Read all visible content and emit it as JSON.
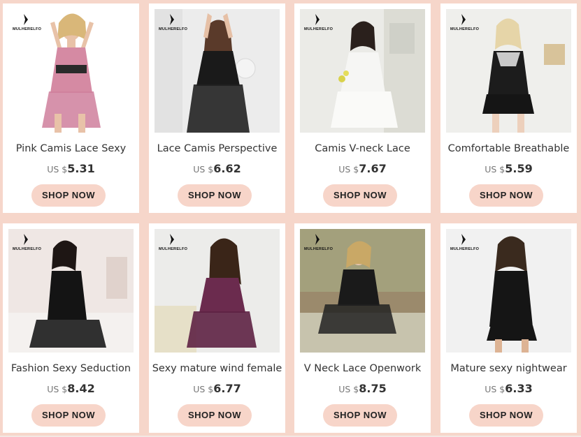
{
  "brand_name": "MULHERELFO",
  "shop_label": "SHOP NOW",
  "currency_prefix": "US $",
  "colors": {
    "page_bg": "#f6d6ca",
    "button_bg": "#f7d5c9",
    "card_bg": "#ffffff"
  },
  "products": [
    {
      "title": "Pink Camis Lace Sexy",
      "price": "5.31",
      "theme": "pink"
    },
    {
      "title": "Lace Camis Perspective",
      "price": "6.62",
      "theme": "black"
    },
    {
      "title": "Camis V-neck Lace",
      "price": "7.67",
      "theme": "white"
    },
    {
      "title": "Comfortable Breathable",
      "price": "5.59",
      "theme": "black-satin"
    },
    {
      "title": "Fashion Sexy Seduction",
      "price": "8.42",
      "theme": "black-lace"
    },
    {
      "title": "Sexy mature wind female",
      "price": "6.77",
      "theme": "purple"
    },
    {
      "title": "V Neck Lace Openwork",
      "price": "8.75",
      "theme": "black-sheer"
    },
    {
      "title": "Mature sexy nightwear",
      "price": "6.33",
      "theme": "black-dress"
    }
  ]
}
